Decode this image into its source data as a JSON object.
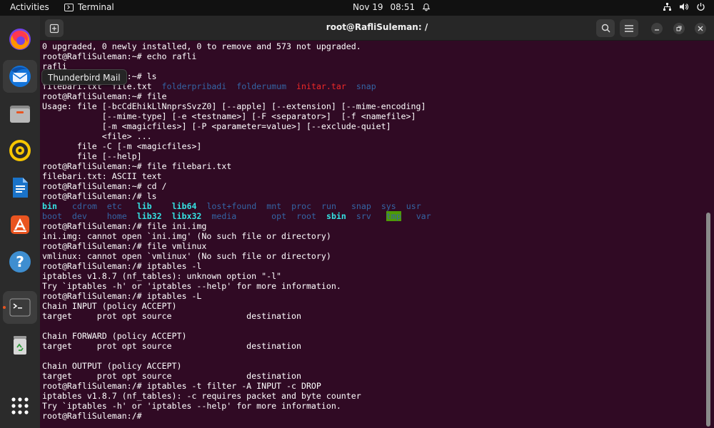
{
  "topbar": {
    "activities": "Activities",
    "app_name": "Terminal",
    "date": "Nov 19",
    "time": "08:51"
  },
  "dock": {
    "tooltip": "Thunderbird Mail",
    "items": [
      "firefox-icon",
      "thunderbird-icon",
      "files-icon",
      "rhythmbox-icon",
      "libreoffice-writer-icon",
      "app-center-icon",
      "help-icon",
      "terminal-icon",
      "trash-icon",
      "show-apps-icon"
    ]
  },
  "window": {
    "title": "root@RafliSuleman: /"
  },
  "colors": {
    "terminal_bg": "#300a24",
    "dir_blue": "#3465a4",
    "archive_red": "#ef2929",
    "link_cyan": "#34e2e2",
    "accent": "#e95420"
  },
  "terminal": {
    "lines": [
      [
        {
          "t": "0 upgraded, 0 newly installed, 0 to remove and 573 not upgraded."
        }
      ],
      [
        {
          "t": "root@RafliSuleman:~# echo rafli"
        }
      ],
      [
        {
          "t": "rafli"
        }
      ],
      [
        {
          "t": "root@RafliSuleman:~# ls"
        }
      ],
      [
        {
          "t": "filebari.txt  file.txt  "
        },
        {
          "t": "folderpribadi",
          "c": "c-blue"
        },
        {
          "t": "  "
        },
        {
          "t": "folderumum",
          "c": "c-blue"
        },
        {
          "t": "  "
        },
        {
          "t": "initar.tar",
          "c": "c-red"
        },
        {
          "t": "  "
        },
        {
          "t": "snap",
          "c": "c-blue"
        }
      ],
      [
        {
          "t": "root@RafliSuleman:~# file"
        }
      ],
      [
        {
          "t": "Usage: file [-bcCdEhikLlNnprsSvzZ0] [--apple] [--extension] [--mime-encoding]"
        }
      ],
      [
        {
          "t": "            [--mime-type] [-e <testname>] [-F <separator>]  [-f <namefile>]"
        }
      ],
      [
        {
          "t": "            [-m <magicfiles>] [-P <parameter=value>] [--exclude-quiet]"
        }
      ],
      [
        {
          "t": "            <file> ..."
        }
      ],
      [
        {
          "t": "       file -C [-m <magicfiles>]"
        }
      ],
      [
        {
          "t": "       file [--help]"
        }
      ],
      [
        {
          "t": "root@RafliSuleman:~# file filebari.txt"
        }
      ],
      [
        {
          "t": "filebari.txt: ASCII text"
        }
      ],
      [
        {
          "t": "root@RafliSuleman:~# cd /"
        }
      ],
      [
        {
          "t": "root@RafliSuleman:/# ls"
        }
      ],
      [
        {
          "t": "bin",
          "c": "c-cyanb"
        },
        {
          "t": "   "
        },
        {
          "t": "cdrom",
          "c": "c-blue"
        },
        {
          "t": "  "
        },
        {
          "t": "etc",
          "c": "c-blue"
        },
        {
          "t": "   "
        },
        {
          "t": "lib",
          "c": "c-cyanb"
        },
        {
          "t": "    "
        },
        {
          "t": "lib64",
          "c": "c-cyanb"
        },
        {
          "t": "  "
        },
        {
          "t": "lost+found",
          "c": "c-blue"
        },
        {
          "t": "  "
        },
        {
          "t": "mnt",
          "c": "c-blue"
        },
        {
          "t": "  "
        },
        {
          "t": "proc",
          "c": "c-blue"
        },
        {
          "t": "  "
        },
        {
          "t": "run",
          "c": "c-blue"
        },
        {
          "t": "   "
        },
        {
          "t": "snap",
          "c": "c-blue"
        },
        {
          "t": "  "
        },
        {
          "t": "sys",
          "c": "c-blue"
        },
        {
          "t": "  "
        },
        {
          "t": "usr",
          "c": "c-blue"
        }
      ],
      [
        {
          "t": "boot",
          "c": "c-blue"
        },
        {
          "t": "  "
        },
        {
          "t": "dev",
          "c": "c-blue"
        },
        {
          "t": "    "
        },
        {
          "t": "home",
          "c": "c-blue"
        },
        {
          "t": "  "
        },
        {
          "t": "lib32",
          "c": "c-cyanb"
        },
        {
          "t": "  "
        },
        {
          "t": "libx32",
          "c": "c-cyanb"
        },
        {
          "t": "  "
        },
        {
          "t": "media",
          "c": "c-blue"
        },
        {
          "t": "       "
        },
        {
          "t": "opt",
          "c": "c-blue"
        },
        {
          "t": "  "
        },
        {
          "t": "root",
          "c": "c-blue"
        },
        {
          "t": "  "
        },
        {
          "t": "sbin",
          "c": "c-cyanb"
        },
        {
          "t": "  "
        },
        {
          "t": "srv",
          "c": "c-blue"
        },
        {
          "t": "   "
        },
        {
          "t": "tmp",
          "c": "c-tmp"
        },
        {
          "t": "   "
        },
        {
          "t": "var",
          "c": "c-blue"
        }
      ],
      [
        {
          "t": "root@RafliSuleman:/# file ini.img"
        }
      ],
      [
        {
          "t": "ini.img: cannot open `ini.img' (No such file or directory)"
        }
      ],
      [
        {
          "t": "root@RafliSuleman:/# file vmlinux"
        }
      ],
      [
        {
          "t": "vmlinux: cannot open `vmlinux' (No such file or directory)"
        }
      ],
      [
        {
          "t": "root@RafliSuleman:/# iptables -l"
        }
      ],
      [
        {
          "t": "iptables v1.8.7 (nf_tables): unknown option \"-l\""
        }
      ],
      [
        {
          "t": "Try `iptables -h' or 'iptables --help' for more information."
        }
      ],
      [
        {
          "t": "root@RafliSuleman:/# iptables -L"
        }
      ],
      [
        {
          "t": "Chain INPUT (policy ACCEPT)"
        }
      ],
      [
        {
          "t": "target     prot opt source               destination"
        }
      ],
      [
        {
          "t": ""
        }
      ],
      [
        {
          "t": "Chain FORWARD (policy ACCEPT)"
        }
      ],
      [
        {
          "t": "target     prot opt source               destination"
        }
      ],
      [
        {
          "t": ""
        }
      ],
      [
        {
          "t": "Chain OUTPUT (policy ACCEPT)"
        }
      ],
      [
        {
          "t": "target     prot opt source               destination"
        }
      ],
      [
        {
          "t": "root@RafliSuleman:/# iptables -t filter -A INPUT -c DROP"
        }
      ],
      [
        {
          "t": "iptables v1.8.7 (nf_tables): -c requires packet and byte counter"
        }
      ],
      [
        {
          "t": "Try `iptables -h' or 'iptables --help' for more information."
        }
      ],
      [
        {
          "t": "root@RafliSuleman:/# "
        }
      ]
    ]
  }
}
